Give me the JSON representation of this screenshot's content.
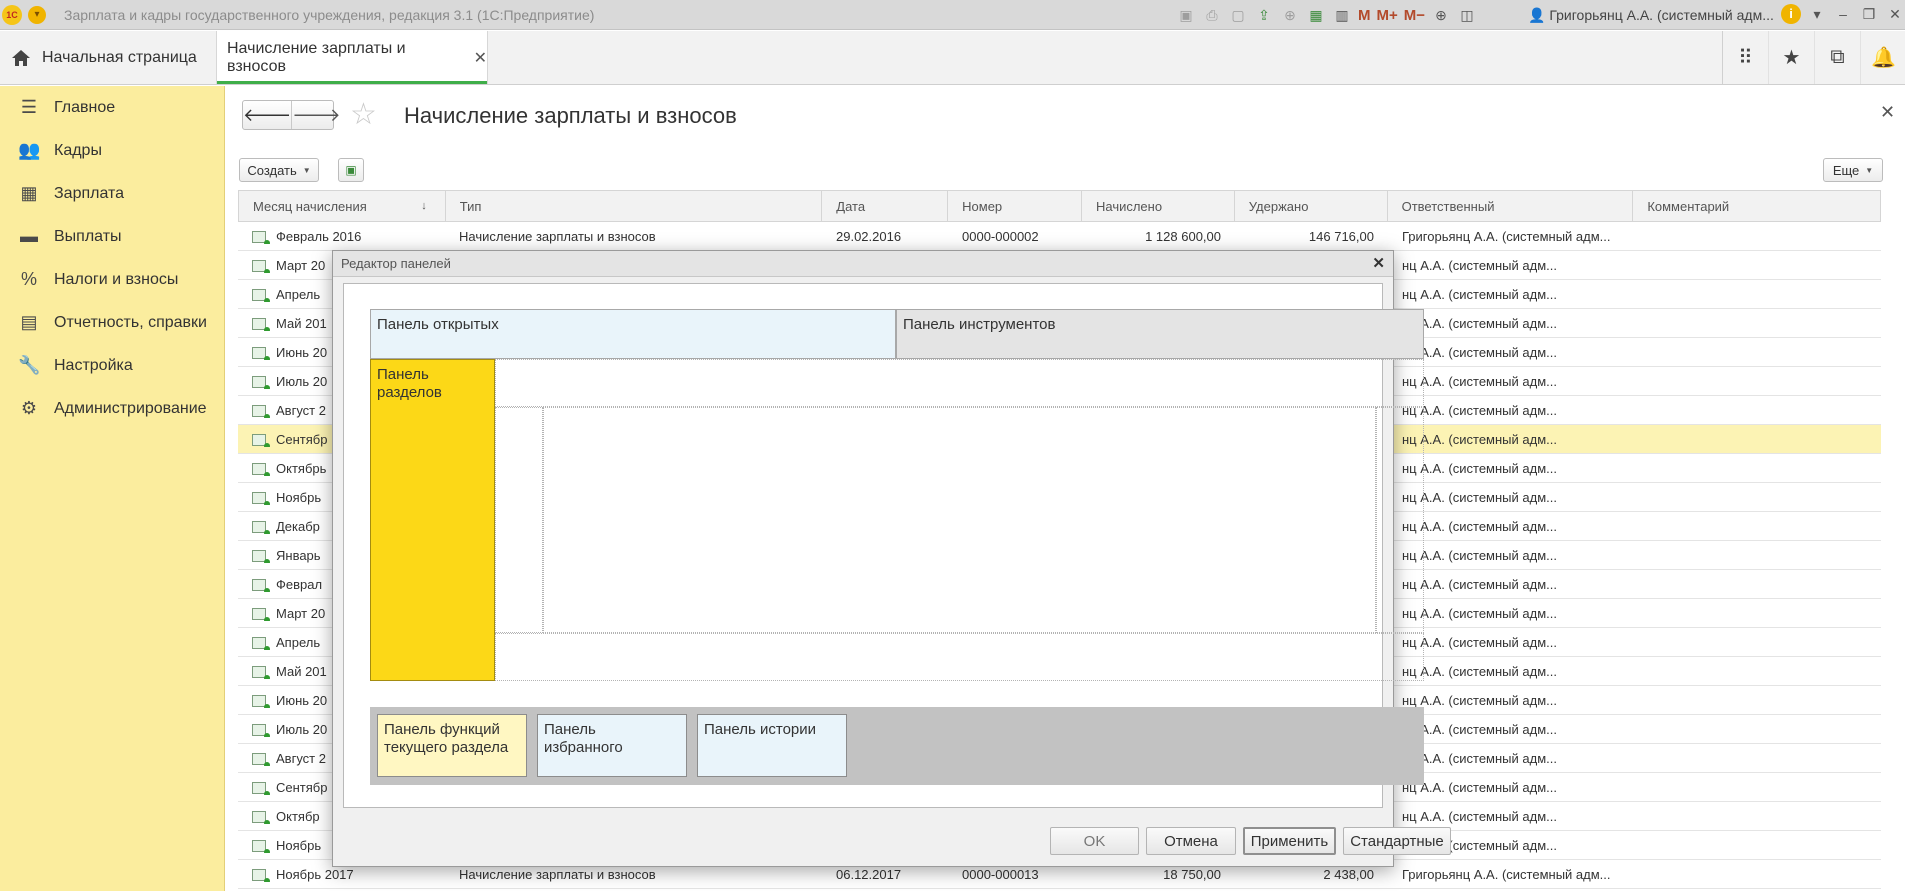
{
  "window": {
    "title": "Зарплата и кадры государственного учреждения, редакция 3.1  (1С:Предприятие)",
    "logo_text": "1С",
    "user": "Григорьянц А.А. (системный адм...",
    "memory_buttons": [
      "M",
      "M+",
      "M−"
    ]
  },
  "tabs": {
    "home_label": "Начальная страница",
    "active_label": "Начисление зарплаты и взносов"
  },
  "sidebar": {
    "items": [
      {
        "label": "Главное",
        "icon": "menu-icon",
        "glyph": "☰"
      },
      {
        "label": "Кадры",
        "icon": "people-icon",
        "glyph": "👥"
      },
      {
        "label": "Зарплата",
        "icon": "calculator-icon",
        "glyph": "▦"
      },
      {
        "label": "Выплаты",
        "icon": "wallet-icon",
        "glyph": "▬"
      },
      {
        "label": "Налоги и взносы",
        "icon": "percent-icon",
        "glyph": "%"
      },
      {
        "label": "Отчетность, справки",
        "icon": "reports-icon",
        "glyph": "▤"
      },
      {
        "label": "Настройка",
        "icon": "wrench-icon",
        "glyph": "🔧"
      },
      {
        "label": "Администрирование",
        "icon": "gear-icon",
        "glyph": "⚙"
      }
    ]
  },
  "page": {
    "title": "Начисление зарплаты и взносов",
    "create_label": "Создать",
    "more_label": "Еще"
  },
  "table": {
    "columns": [
      "Месяц начисления",
      "Тип",
      "Дата",
      "Номер",
      "Начислено",
      "Удержано",
      "Ответственный",
      "Комментарий"
    ],
    "rows": [
      {
        "month": "Февраль 2016",
        "type": "Начисление зарплаты и взносов",
        "date": "29.02.2016",
        "number": "0000-000002",
        "accrued": "1 128 600,00",
        "withheld": "146 716,00",
        "resp": "Григорьянц А.А. (системный адм..."
      },
      {
        "month": "Март 20",
        "type": "",
        "date": "",
        "number": "",
        "accrued": "",
        "withheld": "",
        "resp": "нц А.А. (системный адм..."
      },
      {
        "month": "Апрель",
        "type": "",
        "date": "",
        "number": "",
        "accrued": "",
        "withheld": "",
        "resp": "нц А.А. (системный адм..."
      },
      {
        "month": "Май 201",
        "type": "",
        "date": "",
        "number": "",
        "accrued": "",
        "withheld": "",
        "resp": "нц А.А. (системный адм..."
      },
      {
        "month": "Июнь 20",
        "type": "",
        "date": "",
        "number": "",
        "accrued": "",
        "withheld": "",
        "resp": "нц А.А. (системный адм..."
      },
      {
        "month": "Июль 20",
        "type": "",
        "date": "",
        "number": "",
        "accrued": "",
        "withheld": "",
        "resp": "нц А.А. (системный адм..."
      },
      {
        "month": "Август 2",
        "type": "",
        "date": "",
        "number": "",
        "accrued": "",
        "withheld": "",
        "resp": "нц А.А. (системный адм..."
      },
      {
        "month": "Сентябр",
        "type": "",
        "date": "",
        "number": "",
        "accrued": "",
        "withheld": "",
        "resp": "нц А.А. (системный адм...",
        "selected": true
      },
      {
        "month": "Октябрь",
        "type": "",
        "date": "",
        "number": "",
        "accrued": "",
        "withheld": "",
        "resp": "нц А.А. (системный адм..."
      },
      {
        "month": "Ноябрь",
        "type": "",
        "date": "",
        "number": "",
        "accrued": "",
        "withheld": "",
        "resp": "нц А.А. (системный адм..."
      },
      {
        "month": "Декабр",
        "type": "",
        "date": "",
        "number": "",
        "accrued": "",
        "withheld": "",
        "resp": "нц А.А. (системный адм..."
      },
      {
        "month": "Январь",
        "type": "",
        "date": "",
        "number": "",
        "accrued": "",
        "withheld": "",
        "resp": "нц А.А. (системный адм..."
      },
      {
        "month": "Феврал",
        "type": "",
        "date": "",
        "number": "",
        "accrued": "",
        "withheld": "",
        "resp": "нц А.А. (системный адм..."
      },
      {
        "month": "Март 20",
        "type": "",
        "date": "",
        "number": "",
        "accrued": "",
        "withheld": "",
        "resp": "нц А.А. (системный адм..."
      },
      {
        "month": "Апрель",
        "type": "",
        "date": "",
        "number": "",
        "accrued": "",
        "withheld": "",
        "resp": "нц А.А. (системный адм..."
      },
      {
        "month": "Май 201",
        "type": "",
        "date": "",
        "number": "",
        "accrued": "",
        "withheld": "",
        "resp": "нц А.А. (системный адм..."
      },
      {
        "month": "Июнь 20",
        "type": "",
        "date": "",
        "number": "",
        "accrued": "",
        "withheld": "",
        "resp": "нц А.А. (системный адм..."
      },
      {
        "month": "Июль 20",
        "type": "",
        "date": "",
        "number": "",
        "accrued": "",
        "withheld": "",
        "resp": "нц А.А. (системный адм..."
      },
      {
        "month": "Август 2",
        "type": "",
        "date": "",
        "number": "",
        "accrued": "",
        "withheld": "",
        "resp": "нц А.А. (системный адм..."
      },
      {
        "month": "Сентябр",
        "type": "",
        "date": "",
        "number": "",
        "accrued": "",
        "withheld": "",
        "resp": "нц А.А. (системный адм..."
      },
      {
        "month": "Октябр",
        "type": "",
        "date": "",
        "number": "",
        "accrued": "",
        "withheld": "",
        "resp": "нц А.А. (системный адм..."
      },
      {
        "month": "Ноябрь",
        "type": "",
        "date": "",
        "number": "",
        "accrued": "",
        "withheld": "",
        "resp": "нц А.А. (системный адм..."
      },
      {
        "month": "Ноябрь 2017",
        "type": "Начисление зарплаты и взносов",
        "date": "06.12.2017",
        "number": "0000-000013",
        "accrued": "18 750,00",
        "withheld": "2 438,00",
        "resp": "Григорьянц А.А. (системный адм..."
      }
    ]
  },
  "dialog": {
    "title": "Редактор панелей",
    "panel_open": "Панель открытых",
    "panel_tools": "Панель инструментов",
    "panel_sections": "Панель разделов",
    "panel_functions": "Панель функций текущего раздела",
    "panel_favorites": "Панель избранного",
    "panel_history": "Панель истории",
    "buttons": {
      "ok": "OK",
      "cancel": "Отмена",
      "apply": "Применить",
      "standard": "Стандартные"
    }
  },
  "colors": {
    "sidebar_bg": "#fbed9e",
    "section_panel": "#fcd817",
    "accent_green": "#3fae49",
    "selected_row": "#fcf3b4"
  }
}
